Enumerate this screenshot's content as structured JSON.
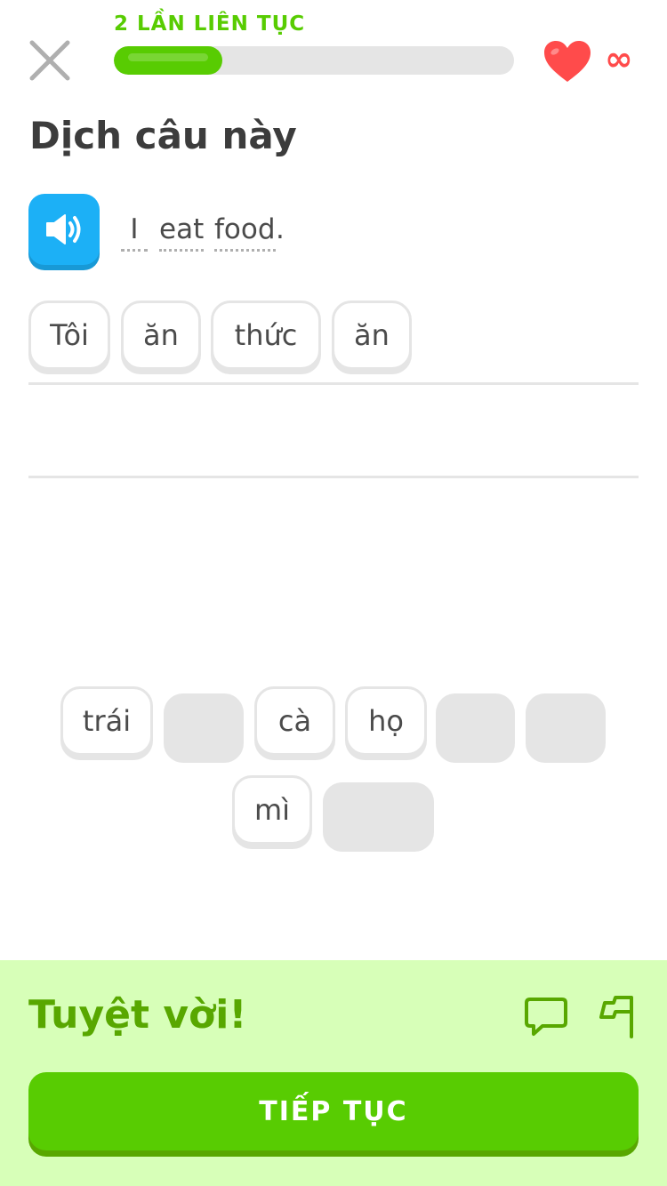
{
  "header": {
    "streak_label": "2 LẦN LIÊN TỤC",
    "progress_fraction": 0.27,
    "hearts": "∞",
    "close_icon": "close-icon",
    "heart_icon": "heart-icon"
  },
  "exercise": {
    "title": "Dịch câu này",
    "speaker_icon": "speaker-icon",
    "prompt_words": [
      "I",
      "eat",
      "food"
    ],
    "prompt_punct": "."
  },
  "answer": {
    "tiles": [
      "Tôi",
      "ăn",
      "thức",
      "ăn"
    ]
  },
  "word_bank": {
    "tiles": [
      "trái",
      "",
      "cà",
      "họ",
      "",
      "",
      "mì",
      ""
    ]
  },
  "feedback": {
    "message": "Tuyệt vời!",
    "continue_label": "TIẾP TỤC",
    "comment_icon": "comment-icon",
    "flag_icon": "flag-icon"
  },
  "colors": {
    "accent": "#58cc02",
    "heart": "#ff4b4b",
    "speaker": "#1cb0f6",
    "feedback_bg": "#d7ffb8",
    "feedback_text": "#58a700"
  }
}
